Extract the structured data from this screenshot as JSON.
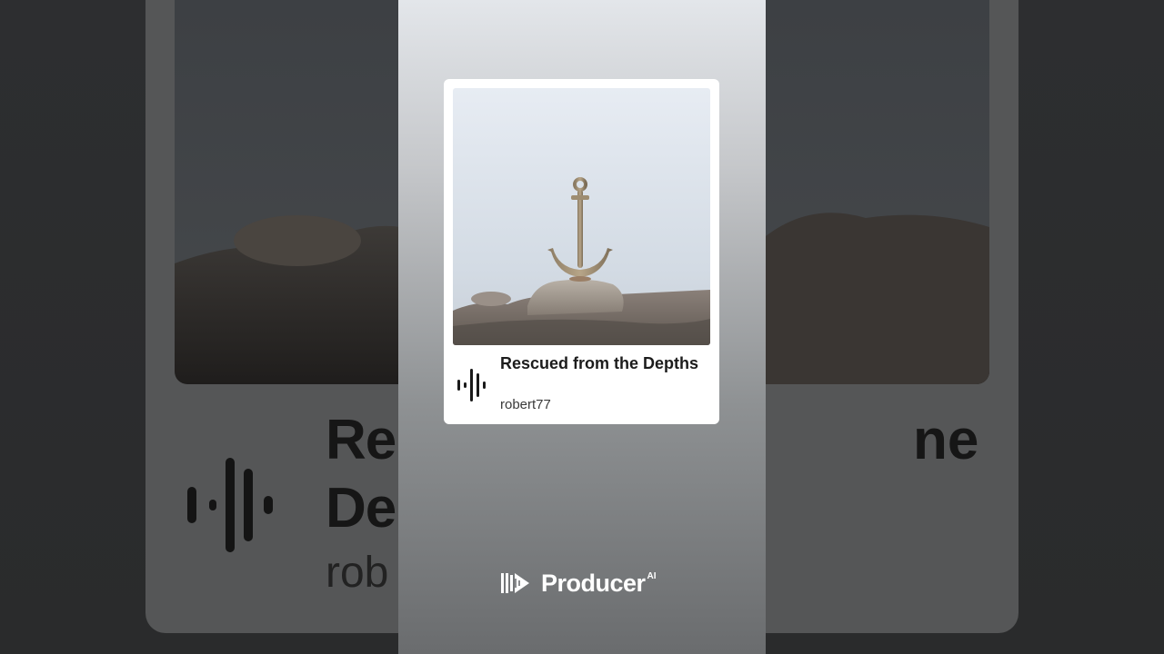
{
  "track": {
    "title": "Rescued from the Depths",
    "artist": "robert77"
  },
  "backdrop": {
    "title_fragment": "Re",
    "title_line2_fragment": "De",
    "title_right_fragment": "ne",
    "artist_fragment": "rob"
  },
  "brand": {
    "name": "Producer",
    "suffix": "AI"
  },
  "icons": {
    "waveform": "audio-waveform-icon",
    "logo": "producer-logo-icon"
  },
  "colors": {
    "card_bg": "#ffffff",
    "panel_top": "#e3e6ea",
    "panel_bottom": "#6a6c6e",
    "text_dark": "#1c1c1c",
    "brand_text": "#ffffff"
  }
}
